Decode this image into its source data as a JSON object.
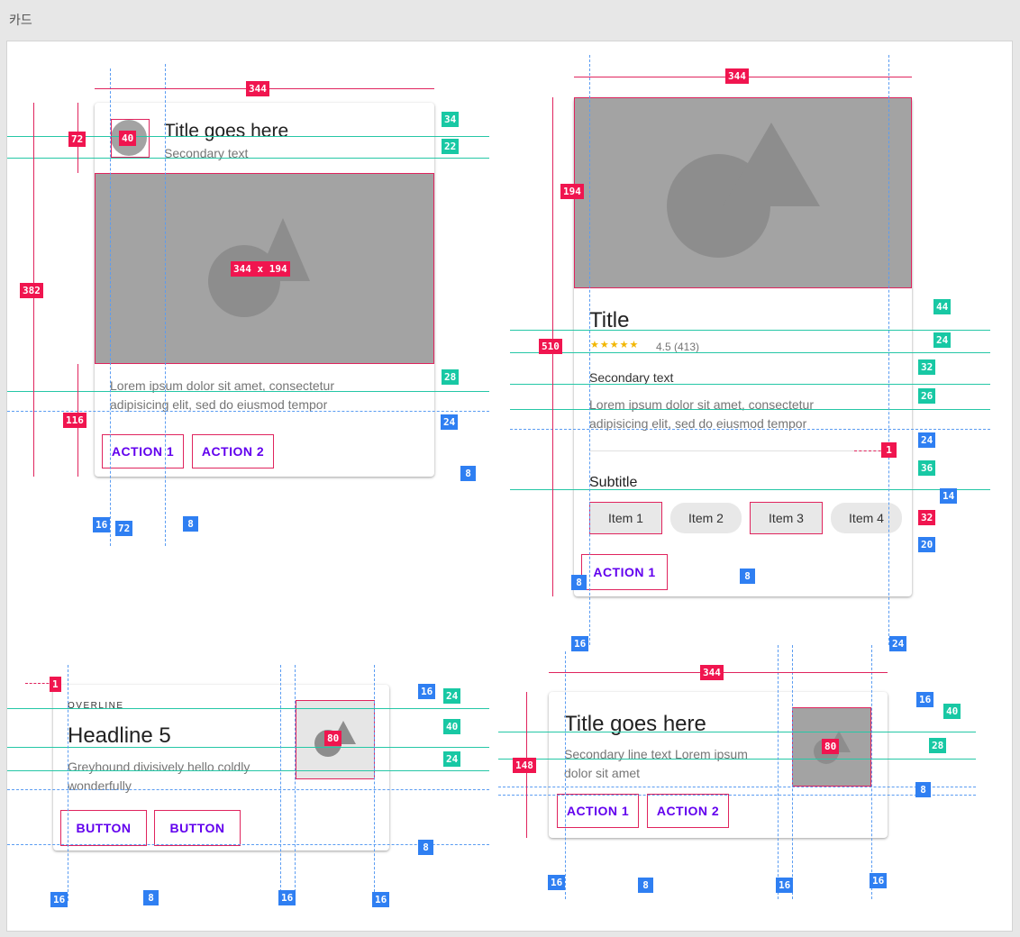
{
  "page": {
    "title": "카드"
  },
  "card1": {
    "title": "Title goes here",
    "secondary": "Secondary text",
    "body_line1": "Lorem ipsum dolor sit amet, consectetur",
    "body_line2": "adipisicing elit, sed do eiusmod tempor",
    "action1": "ACTION 1",
    "action2": "ACTION 2",
    "media_label": "344 x 194",
    "avatar_label": "40",
    "dims": {
      "width": "344",
      "height": "382",
      "header": "72",
      "title_base": "34",
      "sec_base": "22",
      "body_top": "28",
      "body_gap": "24",
      "actions_h": "116",
      "btn_pad": "8",
      "left_pad": "16",
      "text_left": "72",
      "btn_gap": "8"
    }
  },
  "card2": {
    "title": "Title",
    "rating_stars": "★★★★★",
    "rating_text": "4.5 (413)",
    "secondary": "Secondary text",
    "body_line1": "Lorem ipsum dolor sit amet, consectetur",
    "body_line2": "adipisicing elit, sed do eiusmod tempor",
    "subtitle": "Subtitle",
    "chips": [
      "Item 1",
      "Item 2",
      "Item 3",
      "Item 4"
    ],
    "action1": "ACTION 1",
    "dims": {
      "width": "344",
      "height": "510",
      "media_h": "194",
      "title_base": "44",
      "rating_base": "24",
      "sec_base": "32",
      "body_base": "26",
      "body_gap": "24",
      "divider": "1",
      "subtitle_base": "36",
      "chip_gap": "14",
      "chip_h": "32",
      "chip_bottom": "20",
      "chip_space": "8",
      "btn_left": "8",
      "left_pad": "16",
      "right_pad": "24"
    }
  },
  "card3": {
    "overline": "OVERLINE",
    "headline": "Headline 5",
    "body_line1": "Greyhound divisively hello coldly",
    "body_line2": "wonderfully",
    "button1": "BUTTON",
    "button2": "BUTTON",
    "thumb_label": "80",
    "dims": {
      "divider": "1",
      "top_pad": "16",
      "overline_base": "24",
      "headline_base": "40",
      "body_base": "24",
      "bottom_pad": "8",
      "left_pad": "16",
      "btn_gap": "8",
      "thumb_gap": "16",
      "right_pad": "16"
    }
  },
  "card4": {
    "title": "Title goes here",
    "body_line1": "Secondary line text Lorem ipsum",
    "body_line2": "dolor sit amet",
    "action1": "ACTION 1",
    "action2": "ACTION 2",
    "thumb_label": "80",
    "dims": {
      "width": "344",
      "height": "148",
      "top_pad": "16",
      "title_base": "40",
      "sec_base": "28",
      "btn_pad": "8",
      "left_pad": "16",
      "btn_gap": "8",
      "thumb_gap": "16",
      "right_pad": "16"
    }
  }
}
